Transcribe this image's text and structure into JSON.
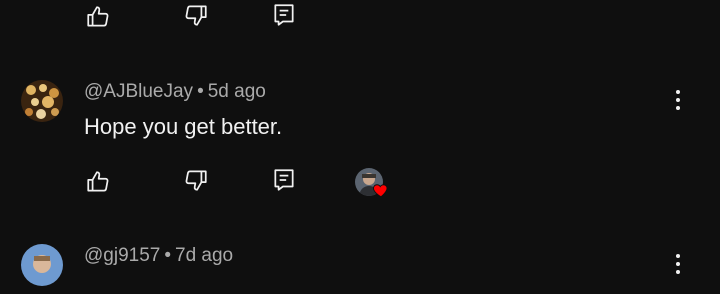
{
  "comments": [
    {
      "author": "@AJBlueJay",
      "separator": "•",
      "age": "5d ago",
      "text": "Hope you get better."
    },
    {
      "author": "@gj9157",
      "separator": "•",
      "age": "7d ago"
    }
  ],
  "icons": {
    "like": "thumbs-up-icon",
    "dislike": "thumbs-down-icon",
    "reply": "reply-icon",
    "menu": "more-vert-icon",
    "heart": "heart-icon"
  },
  "colors": {
    "background": "#0f0f0f",
    "text": "#f1f1f1",
    "meta": "#aaaaaa",
    "heart": "#ff0000"
  }
}
